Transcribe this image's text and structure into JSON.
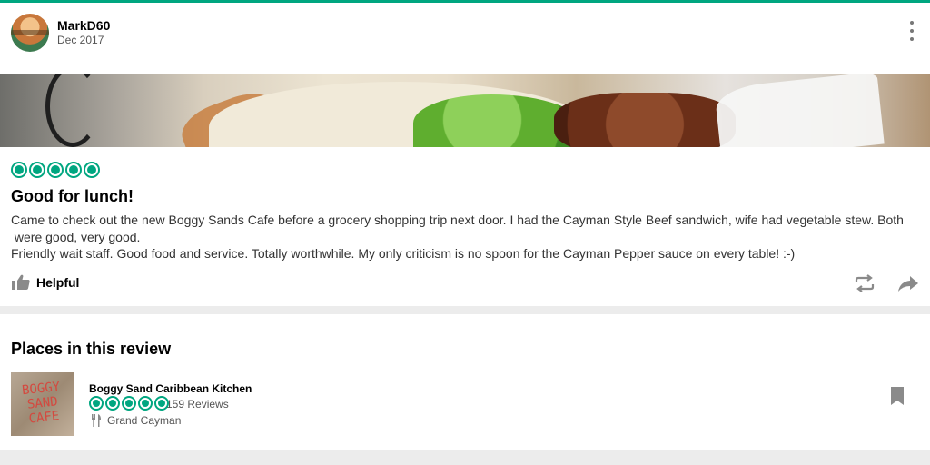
{
  "review": {
    "username": "MarkD60",
    "date": "Dec 2017",
    "rating": 5,
    "title": "Good for lunch!",
    "body": "Came to check out the new Boggy Sands Cafe before a grocery shopping trip next door. I had the Cayman Style Beef sandwich, wife had vegetable stew. Both\n were good, very good.\nFriendly wait staff. Good food and service. Totally worthwhile. My only criticism is no spoon for the Cayman Pepper sauce on every table! :-)",
    "helpful_label": "Helpful"
  },
  "places": {
    "heading": "Places in this review",
    "items": [
      {
        "name": "Boggy Sand Caribbean Kitchen",
        "rating": 5,
        "reviews": "159 Reviews",
        "location": "Grand Cayman",
        "thumb_text": "BOGGY SAND CAFE"
      }
    ]
  },
  "colors": {
    "accent": "#00a680",
    "icon_gray": "#8a8a8a"
  },
  "icons": [
    "avatar",
    "more-options-icon",
    "bubble-rating-icon",
    "thumbs-up-icon",
    "repost-icon",
    "share-icon",
    "restaurant-fork-icon",
    "bookmark-icon"
  ]
}
